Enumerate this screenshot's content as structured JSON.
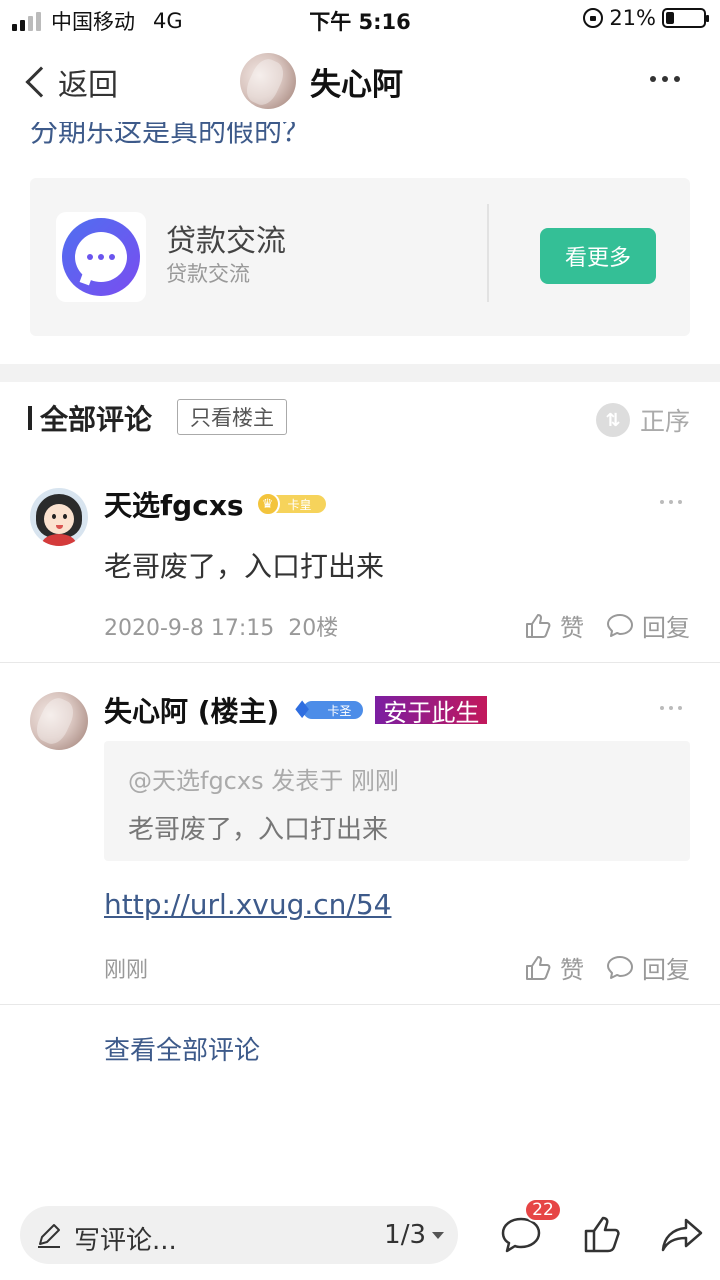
{
  "status_bar": {
    "carrier": "中国移动",
    "network": "4G",
    "time": "下午 5:16",
    "battery": "21%",
    "battery_level": 0.21
  },
  "nav": {
    "back_label": "返回",
    "title": "失心阿"
  },
  "post": {
    "title_fragment": "分期乐这是真的假的？"
  },
  "group_card": {
    "name": "贷款交流",
    "subtitle": "贷款交流",
    "see_more_label": "看更多"
  },
  "comments_header": {
    "title": "全部评论",
    "op_only_label": "只看楼主",
    "sort_label": "正序"
  },
  "comments": [
    {
      "author": "天选fgcxs",
      "badge": "卡皇",
      "content": "老哥废了，入口打出来",
      "time": "2020-9-8 17:15",
      "floor": "20楼",
      "like_label": "赞",
      "reply_label": "回复"
    },
    {
      "author": "失心阿 (楼主)",
      "badge": "卡圣",
      "title_tag": "安于此生",
      "quote_meta": "@天选fgcxs 发表于 刚刚",
      "quote_text": "老哥废了，入口打出来",
      "link": "http://url.xvug.cn/54",
      "time": "刚刚",
      "like_label": "赞",
      "reply_label": "回复"
    }
  ],
  "view_all_label": "查看全部评论",
  "bottom_bar": {
    "write_label": "写评论...",
    "page_indicator": "1/3",
    "comment_count": "22"
  },
  "colors": {
    "accent_green": "#34bf96",
    "link_blue": "#3d5a8a",
    "badge_red": "#e64545"
  }
}
